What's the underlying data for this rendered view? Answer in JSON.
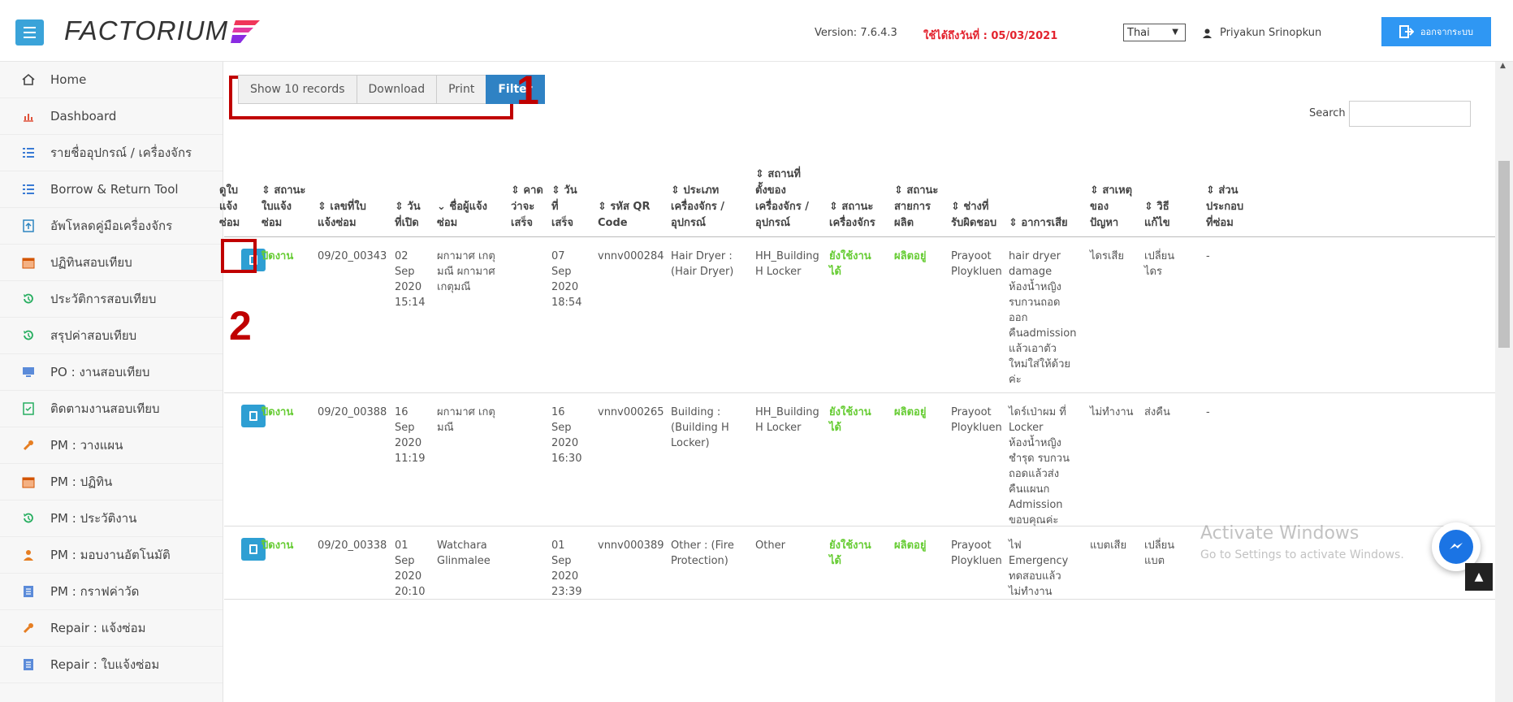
{
  "header": {
    "logo_text": "FACTORIUM",
    "version": "Version: 7.6.4.3",
    "expire": "ใช้ได้ถึงวันที่ : 05/03/2021",
    "language": "Thai",
    "user": "Priyakun Srinopkun",
    "logout": "ออกจากระบบ",
    "accent_color": "#2f97f3"
  },
  "sidebar": {
    "items": [
      {
        "label": "Home",
        "icon": "home-icon"
      },
      {
        "label": "Dashboard",
        "icon": "bar-chart-icon"
      },
      {
        "label": "รายชื่ออุปกรณ์ / เครื่องจักร",
        "icon": "list-icon"
      },
      {
        "label": "Borrow & Return Tool",
        "icon": "list-icon"
      },
      {
        "label": "อัพโหลดคู่มือเครื่องจักร",
        "icon": "upload-icon"
      },
      {
        "label": "ปฏิทินสอบเทียบ",
        "icon": "calendar-icon"
      },
      {
        "label": "ประวัติการสอบเทียบ",
        "icon": "history-icon"
      },
      {
        "label": "สรุปค่าสอบเทียบ",
        "icon": "history-icon"
      },
      {
        "label": "PO : งานสอบเทียบ",
        "icon": "monitor-icon"
      },
      {
        "label": "ติดตามงานสอบเทียบ",
        "icon": "checklist-icon"
      },
      {
        "label": "PM : วางแผน",
        "icon": "wrench-icon"
      },
      {
        "label": "PM : ปฏิทิน",
        "icon": "calendar-icon"
      },
      {
        "label": "PM : ประวัติงาน",
        "icon": "history-icon"
      },
      {
        "label": "PM : มอบงานอัตโนมัติ",
        "icon": "user-icon"
      },
      {
        "label": "PM : กราฟค่าวัด",
        "icon": "document-icon"
      },
      {
        "label": "Repair : แจ้งซ่อม",
        "icon": "wrench-icon"
      },
      {
        "label": "Repair : ใบแจ้งซ่อม",
        "icon": "document-icon"
      }
    ]
  },
  "toolbar": {
    "show": "Show 10 records",
    "download": "Download",
    "print": "Print",
    "filter": "Filter",
    "annotation_1": "1",
    "annotation_2": "2"
  },
  "search": {
    "label": "Search",
    "value": ""
  },
  "table": {
    "headers": [
      "ดูใบ\nแจ้ง\nซ่อม",
      "⇕ สถานะ\nใบแจ้ง\nซ่อม",
      "⇕ เลขที่ใบ\nแจ้งซ่อม",
      "⇕ วัน\nที่เปิด",
      "⌄ ชื่อผู้แจ้ง\nซ่อม",
      "⇕ คาด\nว่าจะ\nเสร็จ",
      "⇕ วัน\nที่\nเสร็จ",
      "⇕ รหัส QR\nCode",
      "⇕ ประเภท\nเครื่องจักร /\nอุปกรณ์",
      "⇕ สถานที่\nตั้งของ\nเครื่องจักร /\nอุปกรณ์",
      "⇕ สถานะ\nเครื่องจักร",
      "⇕ สถานะ\nสายการ\nผลิต",
      "⇕ ช่างที่\nรับผิดชอบ",
      "⇕ อาการเสีย",
      "⇕ สาเหตุ\nของ\nปัญหา",
      "⇕ วิธี\nแก้ไข",
      "⇕ ส่วน\nประกอบ\nที่ซ่อม"
    ],
    "rows": [
      {
        "status": "ปิดงาน",
        "no": "09/20_00343",
        "open": "02\nSep\n2020\n15:14",
        "reporter": "ผกามาศ เกตุ\nมณี ผกามาศ\nเกตุมณี",
        "expected": "",
        "done": "07\nSep\n2020\n18:54",
        "qr": "vnnv000284",
        "type": "Hair Dryer :\n(Hair Dryer)",
        "location": "HH_Building\nH Locker",
        "machine_status": "ยังใช้งาน\nได้",
        "line_status": "ผลิตอยู่",
        "tech": "Prayoot\nPloykluen",
        "symptom": "hair dryer\ndamage\nห้องน้ำหญิง\nรบกวนถอด\nออก\nคืนadmission\nแล้วเอาตัว\nใหม่ใส่ให้ด้วย\nค่ะ",
        "cause": "ไดรเสีย",
        "fix": "เปลี่ยน\nไดร",
        "parts": "-"
      },
      {
        "status": "ปิดงาน",
        "no": "09/20_00388",
        "open": "16\nSep\n2020\n11:19",
        "reporter": "ผกามาศ เกตุ\nมณี",
        "expected": "",
        "done": "16\nSep\n2020\n16:30",
        "qr": "vnnv000265",
        "type": "Building :\n(Building H\nLocker)",
        "location": "HH_Building\nH Locker",
        "machine_status": "ยังใช้งาน\nได้",
        "line_status": "ผลิตอยู่",
        "tech": "Prayoot\nPloykluen",
        "symptom": "ไดร์เป่าผม ที่\nLocker\nห้องน้ำหญิง\nชำรุด รบกวน\nถอดแล้วส่ง\nคืนแผนก\nAdmission\nขอบคุณค่ะ",
        "cause": "ไม่ทำงาน",
        "fix": "ส่งคืน",
        "parts": "-"
      },
      {
        "status": "ปิดงาน",
        "no": "09/20_00338",
        "open": "01\nSep\n2020\n20:10",
        "reporter": "Watchara\nGlinmalee",
        "expected": "",
        "done": "01\nSep\n2020\n23:39",
        "qr": "vnnv000389",
        "type": "Other : (Fire\nProtection)",
        "location": "Other",
        "machine_status": "ยังใช้งาน\nได้",
        "line_status": "ผลิตอยู่",
        "tech": "Prayoot\nPloykluen",
        "symptom": "ไฟ\nEmergency\nทดสอบแล้ว\nไม่ทำงาน",
        "cause": "แบตเสีย",
        "fix": "เปลี่ยน\nแบต",
        "parts": ""
      }
    ]
  },
  "overlay": {
    "watermark_title": "Activate Windows",
    "watermark_sub": "Go to Settings to activate Windows."
  }
}
